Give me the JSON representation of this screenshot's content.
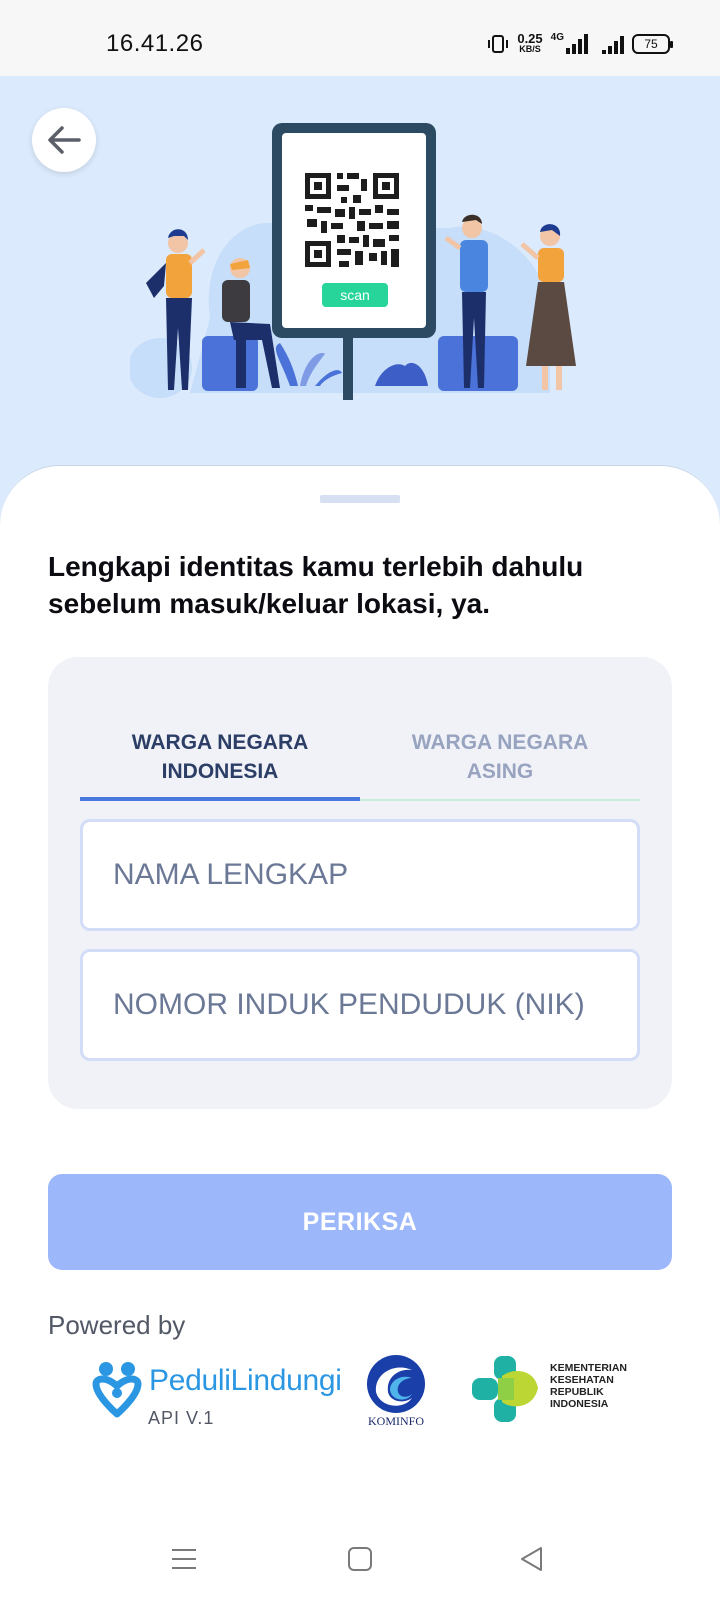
{
  "status_bar": {
    "time": "16.41.26",
    "speed_value": "0.25",
    "speed_unit": "KB/S",
    "network": "4G",
    "battery": "75"
  },
  "hero": {
    "qr_label": "scan"
  },
  "heading": "Lengkapi identitas kamu terlebih dahulu sebelum masuk/keluar lokasi, ya.",
  "tabs": [
    {
      "label": "WARGA NEGARA INDONESIA",
      "active": true
    },
    {
      "label": "WARGA NEGARA ASING",
      "active": false
    }
  ],
  "form": {
    "name_placeholder": "NAMA LENGKAP",
    "name_value": "",
    "nik_placeholder": "NOMOR INDUK PENDUDUK (NIK)",
    "nik_value": ""
  },
  "submit_label": "PERIKSA",
  "footer": {
    "powered_by": "Powered by",
    "peduli_name": "PeduliLindungi",
    "api_version": "API V.1",
    "kominfo": "KOMINFO",
    "kemenkes_lines": [
      "KEMENTERIAN",
      "KESEHATAN",
      "REPUBLIK",
      "INDONESIA"
    ]
  },
  "colors": {
    "hero_bg": "#dbeafc",
    "accent": "#4a78dc",
    "button": "#9db7fb",
    "brand_blue": "#2b97e2",
    "kemenkes_green": "#1fb1a3"
  },
  "icons": {
    "back": "arrow-left-icon",
    "nav_menu": "menu-icon",
    "nav_home": "square-icon",
    "nav_back": "triangle-back-icon"
  }
}
